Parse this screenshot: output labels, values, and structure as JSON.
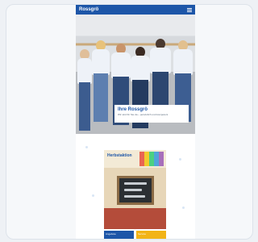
{
  "header": {
    "brand": "Rossgrö"
  },
  "hero": {
    "caption_title": "Ihre Rossgrö",
    "caption_sub": "Wir sind für Sie da – persönlich und kompetent"
  },
  "promo": {
    "title": "Herbstaktion"
  },
  "tiles": [
    {
      "label": "Angebote"
    },
    {
      "label": "Service"
    }
  ],
  "colors": {
    "brand": "#1d56a8",
    "accent": "#f2b417"
  }
}
